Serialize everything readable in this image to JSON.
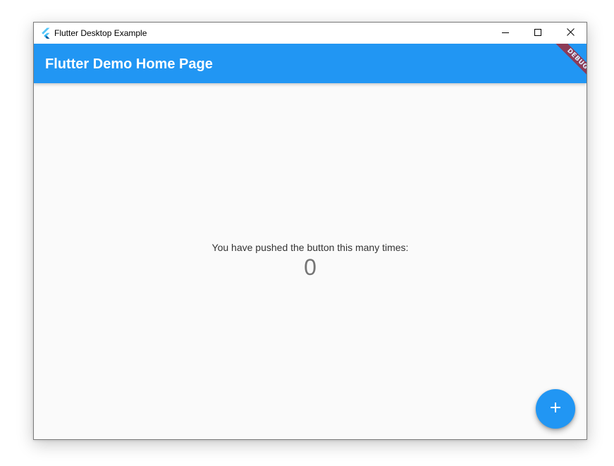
{
  "window": {
    "title": "Flutter Desktop Example",
    "controls": {
      "minimize_icon": "minimize-icon",
      "maximize_icon": "maximize-icon",
      "close_icon": "close-icon"
    }
  },
  "appbar": {
    "title": "Flutter Demo Home Page",
    "color": "#2196f3",
    "debug_banner": "DEBUG"
  },
  "main": {
    "message": "You have pushed the button this many times:",
    "counter": "0"
  },
  "fab": {
    "icon": "add-icon",
    "color": "#2196f3"
  }
}
